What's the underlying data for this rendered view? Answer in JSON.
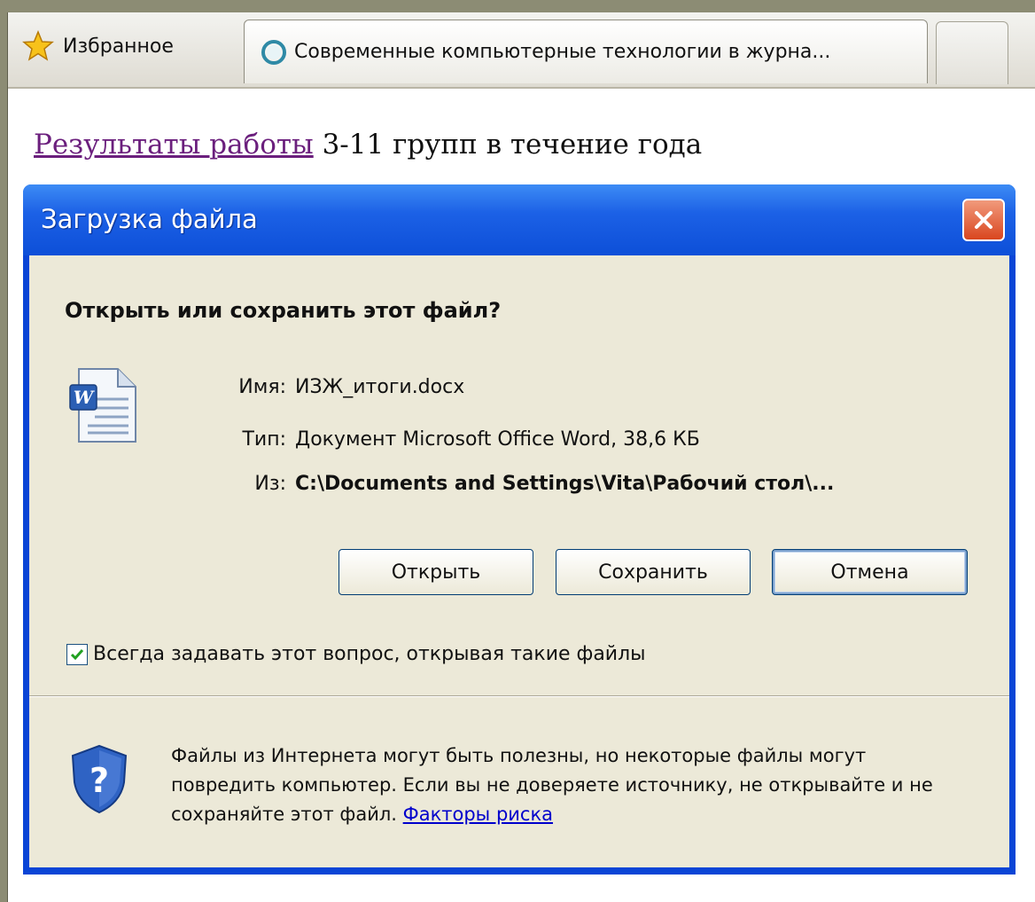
{
  "browser": {
    "favorites_label": "Избранное",
    "tab_title": "Современные компьютерные технологии в журна...",
    "accent_color": "#8c8c74"
  },
  "page": {
    "link_text": "Результаты работы",
    "rest_text": " 3-11 групп в течение года"
  },
  "dialog": {
    "title": "Загрузка файла",
    "question": "Открыть или сохранить этот файл?",
    "name_label": "Имя:",
    "name_value": "ИЗЖ_итоги.docx",
    "type_label": "Тип:",
    "type_value": "Документ Microsoft Office Word, 38,6 КБ",
    "from_label": "Из:",
    "from_value": "C:\\Documents and Settings\\Vita\\Рабочий стол\\...",
    "buttons": {
      "open": "Открыть",
      "save": "Сохранить",
      "cancel": "Отмена"
    },
    "checkbox_label": "Всегда задавать этот вопрос, открывая такие файлы",
    "checkbox_checked": true,
    "warning_text": "Файлы из Интернета могут быть полезны, но некоторые файлы могут повредить компьютер. Если вы не доверяете источнику, не открывайте и не сохраняйте этот файл.",
    "risk_link": "Факторы риска",
    "file_icon": "word-document-icon",
    "security_icon": "shield-question-icon",
    "titlebar_color": "#0a45d6",
    "client_color": "#ece9d8"
  }
}
